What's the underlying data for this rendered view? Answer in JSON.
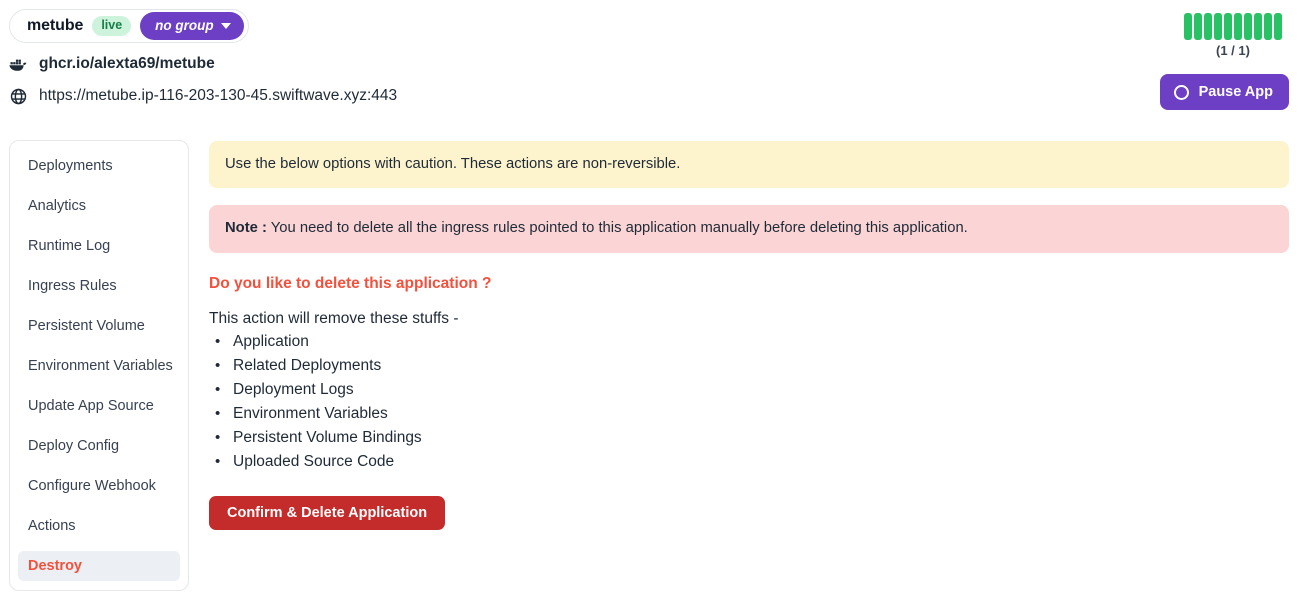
{
  "header": {
    "app_name": "metube",
    "status_badge": "live",
    "group_badge": "no group",
    "image_icon": "docker-whale-icon",
    "image": "ghcr.io/alexta69/metube",
    "url_icon": "globe-icon",
    "url": "https://metube.ip-116-203-130-45.swiftwave.xyz:443",
    "replicas": {
      "count_label": "(1 / 1)",
      "bar_count": 10,
      "bar_color": "#27c263"
    },
    "pause_button": {
      "label": "Pause App",
      "icon": "pause-circle-icon",
      "color": "#6d3fc4"
    }
  },
  "sidebar": {
    "items": [
      {
        "label": "Deployments",
        "active": false
      },
      {
        "label": "Analytics",
        "active": false
      },
      {
        "label": "Runtime Log",
        "active": false
      },
      {
        "label": "Ingress Rules",
        "active": false
      },
      {
        "label": "Persistent Volume",
        "active": false
      },
      {
        "label": "Environment Variables",
        "active": false
      },
      {
        "label": "Update App Source",
        "active": false
      },
      {
        "label": "Deploy Config",
        "active": false
      },
      {
        "label": "Configure Webhook",
        "active": false
      },
      {
        "label": "Actions",
        "active": false
      },
      {
        "label": "Destroy",
        "active": true
      }
    ],
    "active_color": "#f4503c"
  },
  "main": {
    "warning_alert": "Use the below options with caution. These actions are non-reversible.",
    "warning_color": "#fdf3cd",
    "note_prefix": "Note :",
    "note_text": " You need to delete all the ingress rules pointed to this application manually before deleting this application.",
    "note_color": "#fbd5d5",
    "question": "Do you like to delete this application ?",
    "question_color": "#f4503c",
    "lead": "This action will remove these stuffs -",
    "removed_items": [
      "Application",
      "Related Deployments",
      "Deployment Logs",
      "Environment Variables",
      "Persistent Volume Bindings",
      "Uploaded Source Code"
    ],
    "delete_button": {
      "label": "Confirm & Delete Application",
      "color": "#c42b2b"
    }
  }
}
